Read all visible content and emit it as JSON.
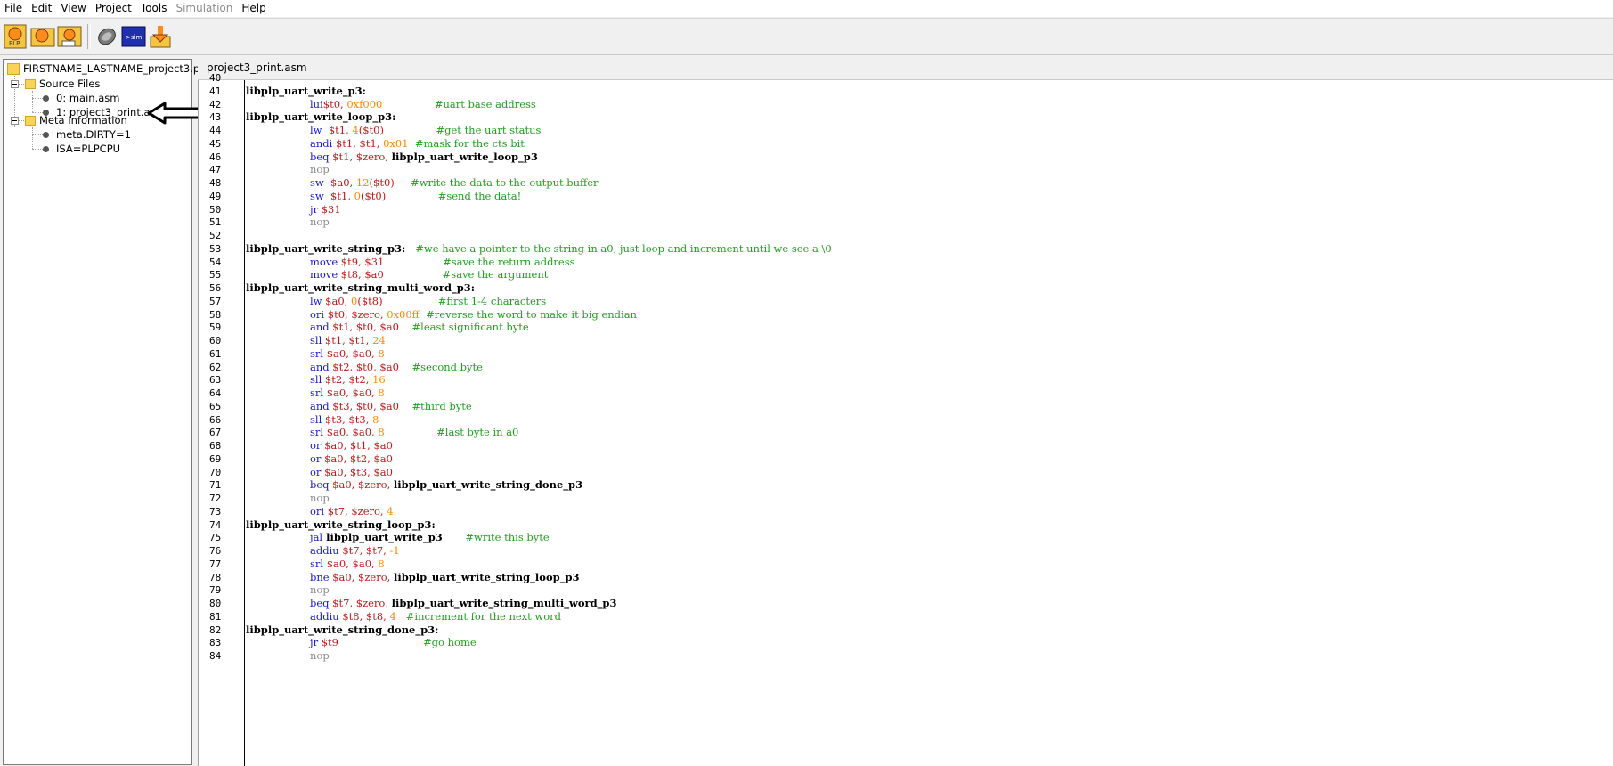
{
  "menu": [
    "File",
    "Edit",
    "View",
    "Project",
    "Tools",
    "Simulation",
    "Help"
  ],
  "menu_disabled": [
    "Simulation"
  ],
  "toolbar": {
    "buttons": [
      "new-project-icon",
      "open-project-icon",
      "save-project-icon",
      "assemble-icon",
      "simulation-icon",
      "program-board-icon"
    ],
    "new_label": "PLP",
    "sim_label": ">sim"
  },
  "tree": {
    "project": "FIRSTNAME_LASTNAME_project3.plp",
    "source_folder": "Source Files",
    "files": [
      "0: main.asm",
      "1: project3_print.asm"
    ],
    "meta_folder": "Meta Information",
    "meta": [
      "meta.DIRTY=1",
      "ISA=PLPCPU"
    ]
  },
  "editor": {
    "tab_title": "project3_print.asm",
    "lines": [
      {
        "n": "40",
        "label": "",
        "instr": "",
        "ops": [],
        "cmt": ""
      },
      {
        "n": "41",
        "label": "libplp_uart_write_p3:",
        "instr": "",
        "ops": [],
        "cmt": ""
      },
      {
        "n": "42",
        "label": "",
        "instr": "lui",
        "ops": [
          [
            "reg",
            "$t0, "
          ],
          [
            "num",
            "0xf000"
          ]
        ],
        "cmt": "#uart base address",
        "pad": "                "
      },
      {
        "n": "43",
        "label": "libplp_uart_write_loop_p3:",
        "instr": "",
        "ops": [],
        "cmt": ""
      },
      {
        "n": "44",
        "label": "",
        "instr": "lw",
        "ops": [
          [
            "reg",
            "  $t1, "
          ],
          [
            "num",
            "4"
          ],
          [
            "reg",
            "($t0)"
          ]
        ],
        "cmt": "#get the uart status",
        "pad": "                "
      },
      {
        "n": "45",
        "label": "",
        "instr": "andi",
        "ops": [
          [
            "reg",
            " $t1, $t1, "
          ],
          [
            "num",
            "0x01"
          ]
        ],
        "cmt": "#mask for the cts bit",
        "pad": "  "
      },
      {
        "n": "46",
        "label": "",
        "instr": "beq",
        "ops": [
          [
            "reg",
            " $t1, $zero, "
          ],
          [
            "sym",
            "libplp_uart_write_loop_p3"
          ]
        ],
        "cmt": ""
      },
      {
        "n": "47",
        "label": "",
        "instr": "nop",
        "ops": [],
        "cmt": "",
        "nop": true
      },
      {
        "n": "48",
        "label": "",
        "instr": "sw",
        "ops": [
          [
            "reg",
            "  $a0, "
          ],
          [
            "num",
            "12"
          ],
          [
            "reg",
            "($t0)"
          ]
        ],
        "cmt": "#write the data to the output buffer",
        "pad": "     "
      },
      {
        "n": "49",
        "label": "",
        "instr": "sw",
        "ops": [
          [
            "reg",
            "  $t1, "
          ],
          [
            "num",
            "0"
          ],
          [
            "reg",
            "($t0)"
          ]
        ],
        "cmt": "#send the data!",
        "pad": "                "
      },
      {
        "n": "50",
        "label": "",
        "instr": "jr",
        "ops": [
          [
            "reg",
            " $31"
          ]
        ],
        "cmt": ""
      },
      {
        "n": "51",
        "label": "",
        "instr": "nop",
        "ops": [],
        "cmt": "",
        "nop": true
      },
      {
        "n": "52",
        "label": "",
        "instr": "",
        "ops": [],
        "cmt": ""
      },
      {
        "n": "53",
        "label": "libplp_uart_write_string_p3:",
        "instr": "",
        "ops": [],
        "cmt": "#we have a pointer to the string in a0, just loop and increment until we see a \\0",
        "lpad": "   "
      },
      {
        "n": "54",
        "label": "",
        "instr": "move",
        "ops": [
          [
            "reg",
            " $t9, $31"
          ]
        ],
        "cmt": "#save the return address",
        "pad": "                  "
      },
      {
        "n": "55",
        "label": "",
        "instr": "move",
        "ops": [
          [
            "reg",
            " $t8, $a0"
          ]
        ],
        "cmt": "#save the argument",
        "pad": "                  "
      },
      {
        "n": "56",
        "label": "libplp_uart_write_string_multi_word_p3:",
        "instr": "",
        "ops": [],
        "cmt": ""
      },
      {
        "n": "57",
        "label": "",
        "instr": "lw",
        "ops": [
          [
            "reg",
            " $a0, "
          ],
          [
            "num",
            "0"
          ],
          [
            "reg",
            "($t8)"
          ]
        ],
        "cmt": "#first 1-4 characters",
        "pad": "                 "
      },
      {
        "n": "58",
        "label": "",
        "instr": "ori",
        "ops": [
          [
            "reg",
            " $t0, $zero, "
          ],
          [
            "num",
            "0x00ff"
          ]
        ],
        "cmt": "#reverse the word to make it big endian",
        "pad": "  "
      },
      {
        "n": "59",
        "label": "",
        "instr": "and",
        "ops": [
          [
            "reg",
            " $t1, $t0, $a0"
          ]
        ],
        "cmt": "#least significant byte",
        "pad": "    "
      },
      {
        "n": "60",
        "label": "",
        "instr": "sll",
        "ops": [
          [
            "reg",
            " $t1, $t1, "
          ],
          [
            "num",
            "24"
          ]
        ],
        "cmt": ""
      },
      {
        "n": "61",
        "label": "",
        "instr": "srl",
        "ops": [
          [
            "reg",
            " $a0, $a0, "
          ],
          [
            "num",
            "8"
          ]
        ],
        "cmt": ""
      },
      {
        "n": "62",
        "label": "",
        "instr": "and",
        "ops": [
          [
            "reg",
            " $t2, $t0, $a0"
          ]
        ],
        "cmt": "#second byte",
        "pad": "    "
      },
      {
        "n": "63",
        "label": "",
        "instr": "sll",
        "ops": [
          [
            "reg",
            " $t2, $t2, "
          ],
          [
            "num",
            "16"
          ]
        ],
        "cmt": ""
      },
      {
        "n": "64",
        "label": "",
        "instr": "srl",
        "ops": [
          [
            "reg",
            " $a0, $a0, "
          ],
          [
            "num",
            "8"
          ]
        ],
        "cmt": ""
      },
      {
        "n": "65",
        "label": "",
        "instr": "and",
        "ops": [
          [
            "reg",
            " $t3, $t0, $a0"
          ]
        ],
        "cmt": "#third byte",
        "pad": "    "
      },
      {
        "n": "66",
        "label": "",
        "instr": "sll",
        "ops": [
          [
            "reg",
            " $t3, $t3, "
          ],
          [
            "num",
            "8"
          ]
        ],
        "cmt": ""
      },
      {
        "n": "67",
        "label": "",
        "instr": "srl",
        "ops": [
          [
            "reg",
            " $a0, $a0, "
          ],
          [
            "num",
            "8"
          ]
        ],
        "cmt": "#last byte in a0",
        "pad": "                "
      },
      {
        "n": "68",
        "label": "",
        "instr": "or",
        "ops": [
          [
            "reg",
            " $a0, $t1, $a0"
          ]
        ],
        "cmt": ""
      },
      {
        "n": "69",
        "label": "",
        "instr": "or",
        "ops": [
          [
            "reg",
            " $a0, $t2, $a0"
          ]
        ],
        "cmt": ""
      },
      {
        "n": "70",
        "label": "",
        "instr": "or",
        "ops": [
          [
            "reg",
            " $a0, $t3, $a0"
          ]
        ],
        "cmt": ""
      },
      {
        "n": "71",
        "label": "",
        "instr": "beq",
        "ops": [
          [
            "reg",
            " $a0, $zero, "
          ],
          [
            "sym",
            "libplp_uart_write_string_done_p3"
          ]
        ],
        "cmt": ""
      },
      {
        "n": "72",
        "label": "",
        "instr": "nop",
        "ops": [],
        "cmt": "",
        "nop": true
      },
      {
        "n": "73",
        "label": "",
        "instr": "ori",
        "ops": [
          [
            "reg",
            " $t7, $zero, "
          ],
          [
            "num",
            "4"
          ]
        ],
        "cmt": ""
      },
      {
        "n": "74",
        "label": "libplp_uart_write_string_loop_p3:",
        "instr": "",
        "ops": [],
        "cmt": ""
      },
      {
        "n": "75",
        "label": "",
        "instr": "jal",
        "ops": [
          [
            "sym",
            " libplp_uart_write_p3"
          ]
        ],
        "cmt": "#write this byte",
        "pad": "       "
      },
      {
        "n": "76",
        "label": "",
        "instr": "addiu",
        "ops": [
          [
            "reg",
            " $t7, $t7, "
          ],
          [
            "num",
            "-1"
          ]
        ],
        "cmt": ""
      },
      {
        "n": "77",
        "label": "",
        "instr": "srl",
        "ops": [
          [
            "reg",
            " $a0, $a0, "
          ],
          [
            "num",
            "8"
          ]
        ],
        "cmt": ""
      },
      {
        "n": "78",
        "label": "",
        "instr": "bne",
        "ops": [
          [
            "reg",
            " $a0, $zero, "
          ],
          [
            "sym",
            "libplp_uart_write_string_loop_p3"
          ]
        ],
        "cmt": ""
      },
      {
        "n": "79",
        "label": "",
        "instr": "nop",
        "ops": [],
        "cmt": "",
        "nop": true
      },
      {
        "n": "80",
        "label": "",
        "instr": "beq",
        "ops": [
          [
            "reg",
            " $t7, $zero, "
          ],
          [
            "sym",
            "libplp_uart_write_string_multi_word_p3"
          ]
        ],
        "cmt": ""
      },
      {
        "n": "81",
        "label": "",
        "instr": "addiu",
        "ops": [
          [
            "reg",
            " $t8, $t8, "
          ],
          [
            "num",
            "4"
          ]
        ],
        "cmt": "#increment for the next word",
        "pad": "   "
      },
      {
        "n": "82",
        "label": "libplp_uart_write_string_done_p3:",
        "instr": "",
        "ops": [],
        "cmt": ""
      },
      {
        "n": "83",
        "label": "",
        "instr": "jr",
        "ops": [
          [
            "reg",
            " $t9"
          ]
        ],
        "cmt": "#go home",
        "pad": "                          "
      },
      {
        "n": "84",
        "label": "",
        "instr": "nop",
        "ops": [],
        "cmt": "",
        "nop": true
      }
    ]
  }
}
